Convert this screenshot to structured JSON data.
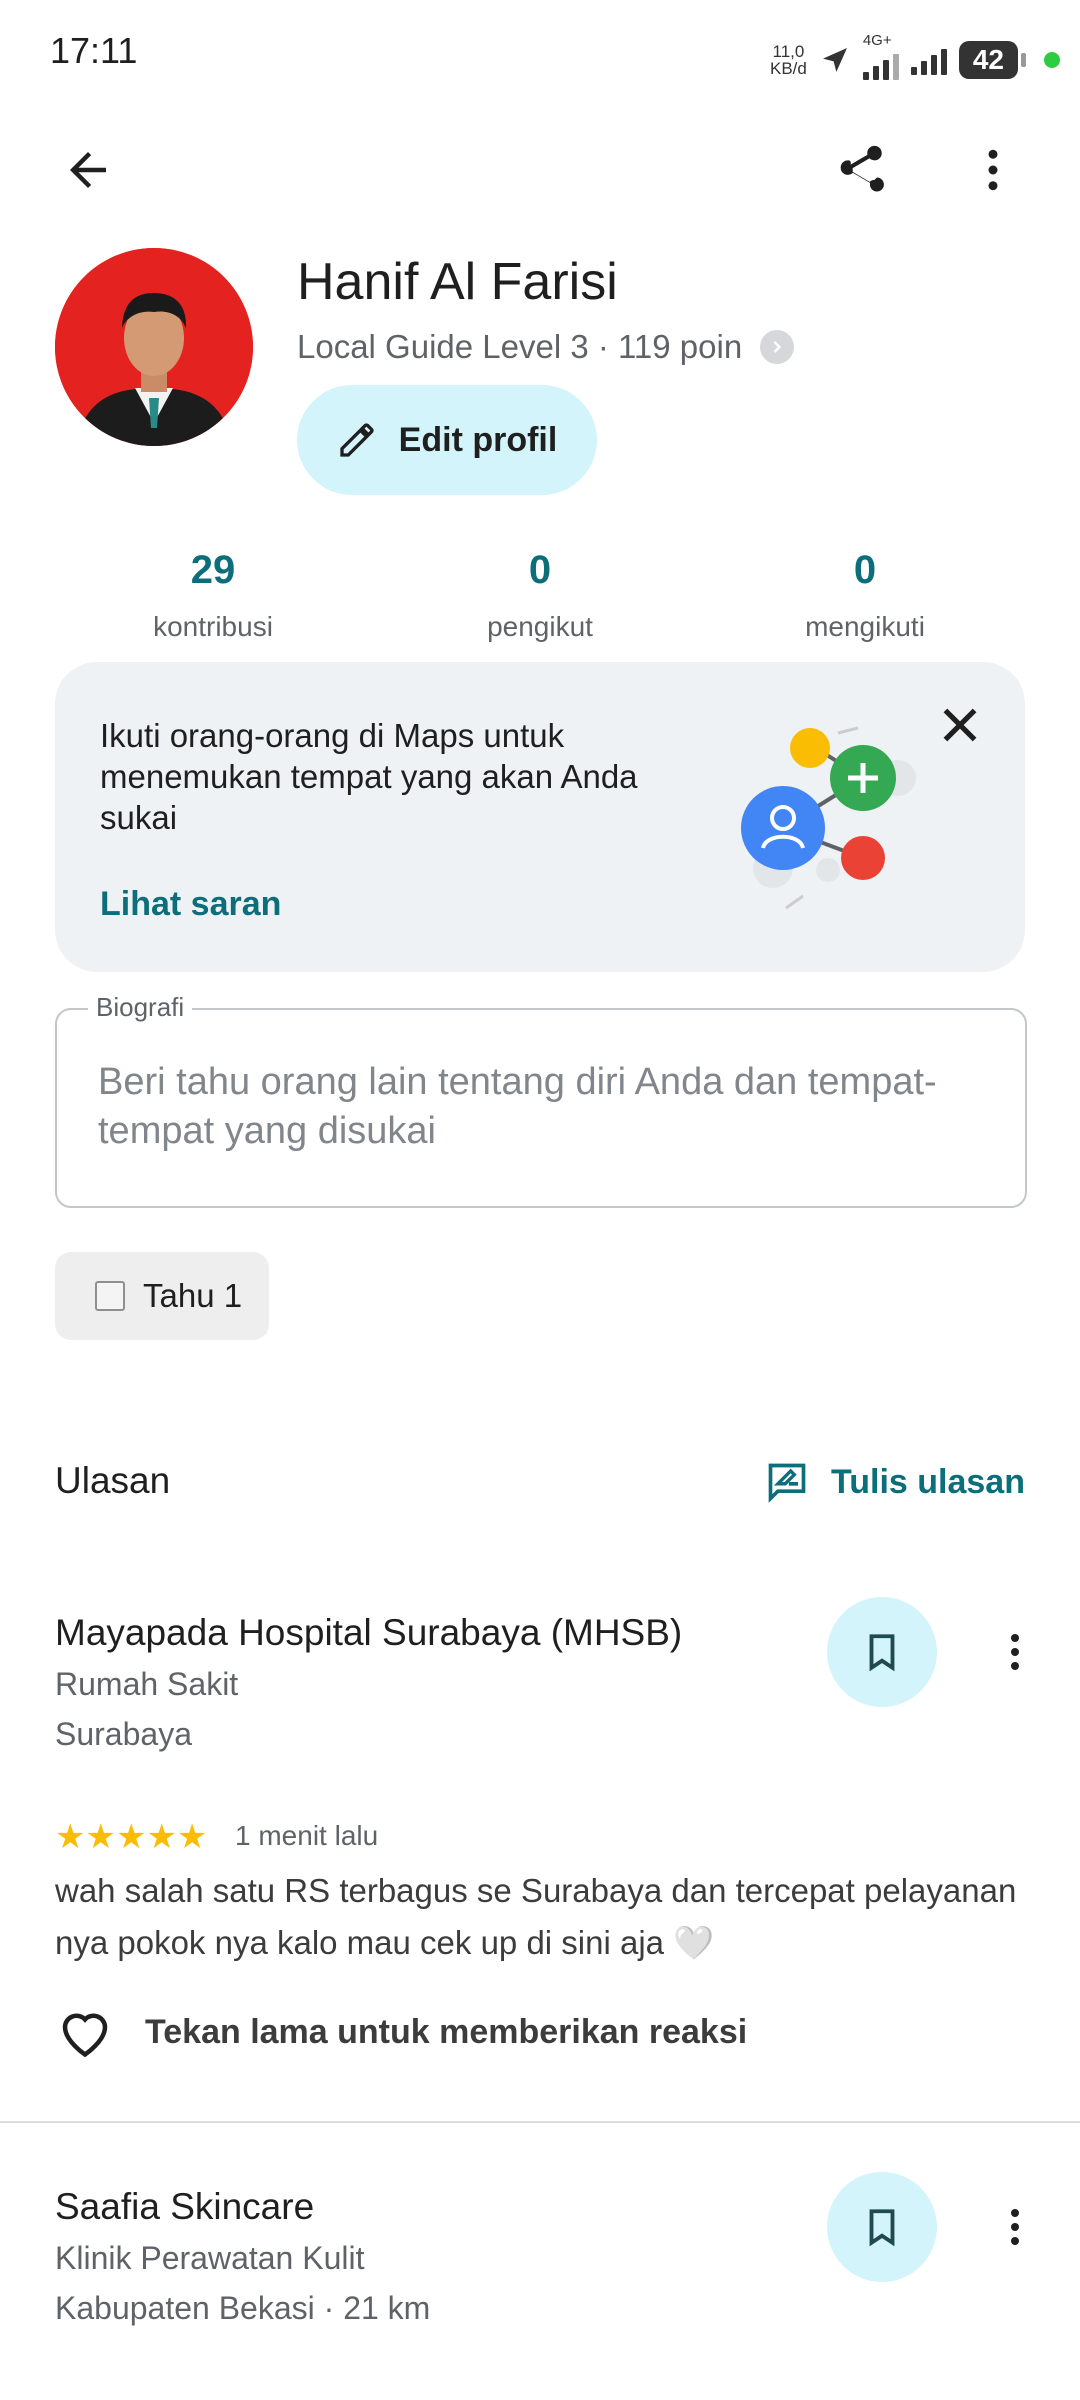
{
  "status_bar": {
    "time": "17:11",
    "net_speed_value": "11,0",
    "net_speed_unit": "KB/d",
    "network_type": "4G+",
    "battery": "42"
  },
  "profile": {
    "name": "Hanif Al Farisi",
    "level": "Local Guide Level 3 · 119 poin",
    "edit_label": "Edit profil"
  },
  "stats": [
    {
      "value": "29",
      "label": "kontribusi"
    },
    {
      "value": "0",
      "label": "pengikut"
    },
    {
      "value": "0",
      "label": "mengikuti"
    }
  ],
  "suggestion_card": {
    "text": "Ikuti orang-orang di Maps untuk menemukan tempat yang akan Anda sukai",
    "link": "Lihat saran"
  },
  "bio": {
    "label": "Biografi",
    "placeholder": "Beri tahu orang lain tentang diri Anda dan tempat-tempat yang disukai"
  },
  "chip": {
    "label": "Tahu 1"
  },
  "reviews": {
    "title": "Ulasan",
    "write_label": "Tulis ulasan",
    "items": [
      {
        "name": "Mayapada Hospital Surabaya (MHSB)",
        "category": "Rumah Sakit",
        "location": "Surabaya",
        "rating": 5,
        "stars": "★★★★★",
        "time": "1 menit lalu",
        "text": "wah salah satu RS terbagus se Surabaya dan tercepat pelayanan nya pokok nya kalo mau cek up di sini aja 🤍",
        "reaction_hint": "Tekan lama untuk memberikan reaksi"
      },
      {
        "name": "Saafia Skincare",
        "category": "Klinik Perawatan Kulit",
        "location": "Kabupaten Bekasi · 21 km"
      }
    ]
  },
  "colors": {
    "accent": "#0b6e7a",
    "button_bg": "#d3f4fb",
    "star": "#fbbc04",
    "avatar_bg": "#e42321"
  }
}
